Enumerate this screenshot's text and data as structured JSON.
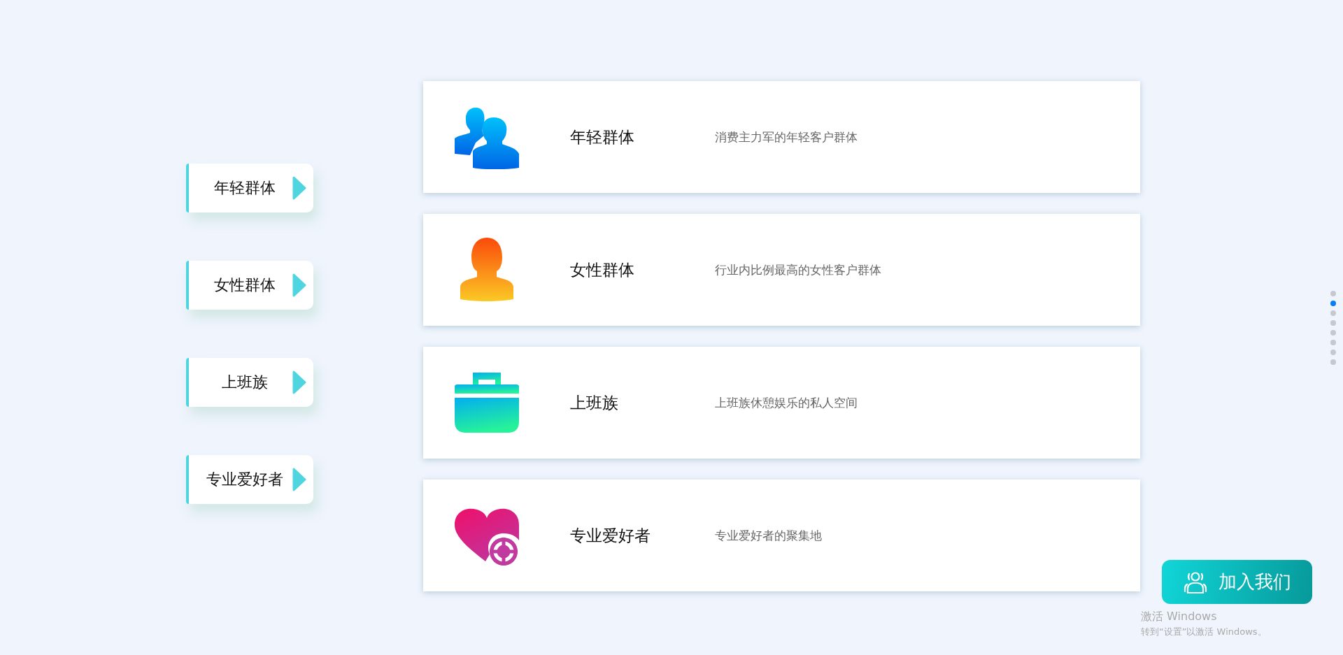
{
  "side_tabs": [
    {
      "label": "年轻群体"
    },
    {
      "label": "女性群体"
    },
    {
      "label": "上班族"
    },
    {
      "label": "专业爱好者"
    }
  ],
  "cards": [
    {
      "kind": "group",
      "title": "年轻群体",
      "description": "消费主力军的年轻客户群体"
    },
    {
      "kind": "woman",
      "title": "女性群体",
      "description": "行业内比例最高的女性客户群体"
    },
    {
      "kind": "briefcase",
      "title": "上班族",
      "description": "上班族休憩娱乐的私人空间"
    },
    {
      "kind": "heart",
      "title": "专业爱好者",
      "description": "专业爱好者的聚集地"
    }
  ],
  "page_dots": [
    {
      "selected": false
    },
    {
      "selected": true
    },
    {
      "selected": false
    },
    {
      "selected": false
    },
    {
      "selected": false
    },
    {
      "selected": false
    },
    {
      "selected": false
    },
    {
      "selected": false
    }
  ],
  "join_button": {
    "label": "加入我们"
  },
  "activation_notice": {
    "title": "激活 Windows",
    "text": "转到“设置”以激活 Windows。"
  }
}
